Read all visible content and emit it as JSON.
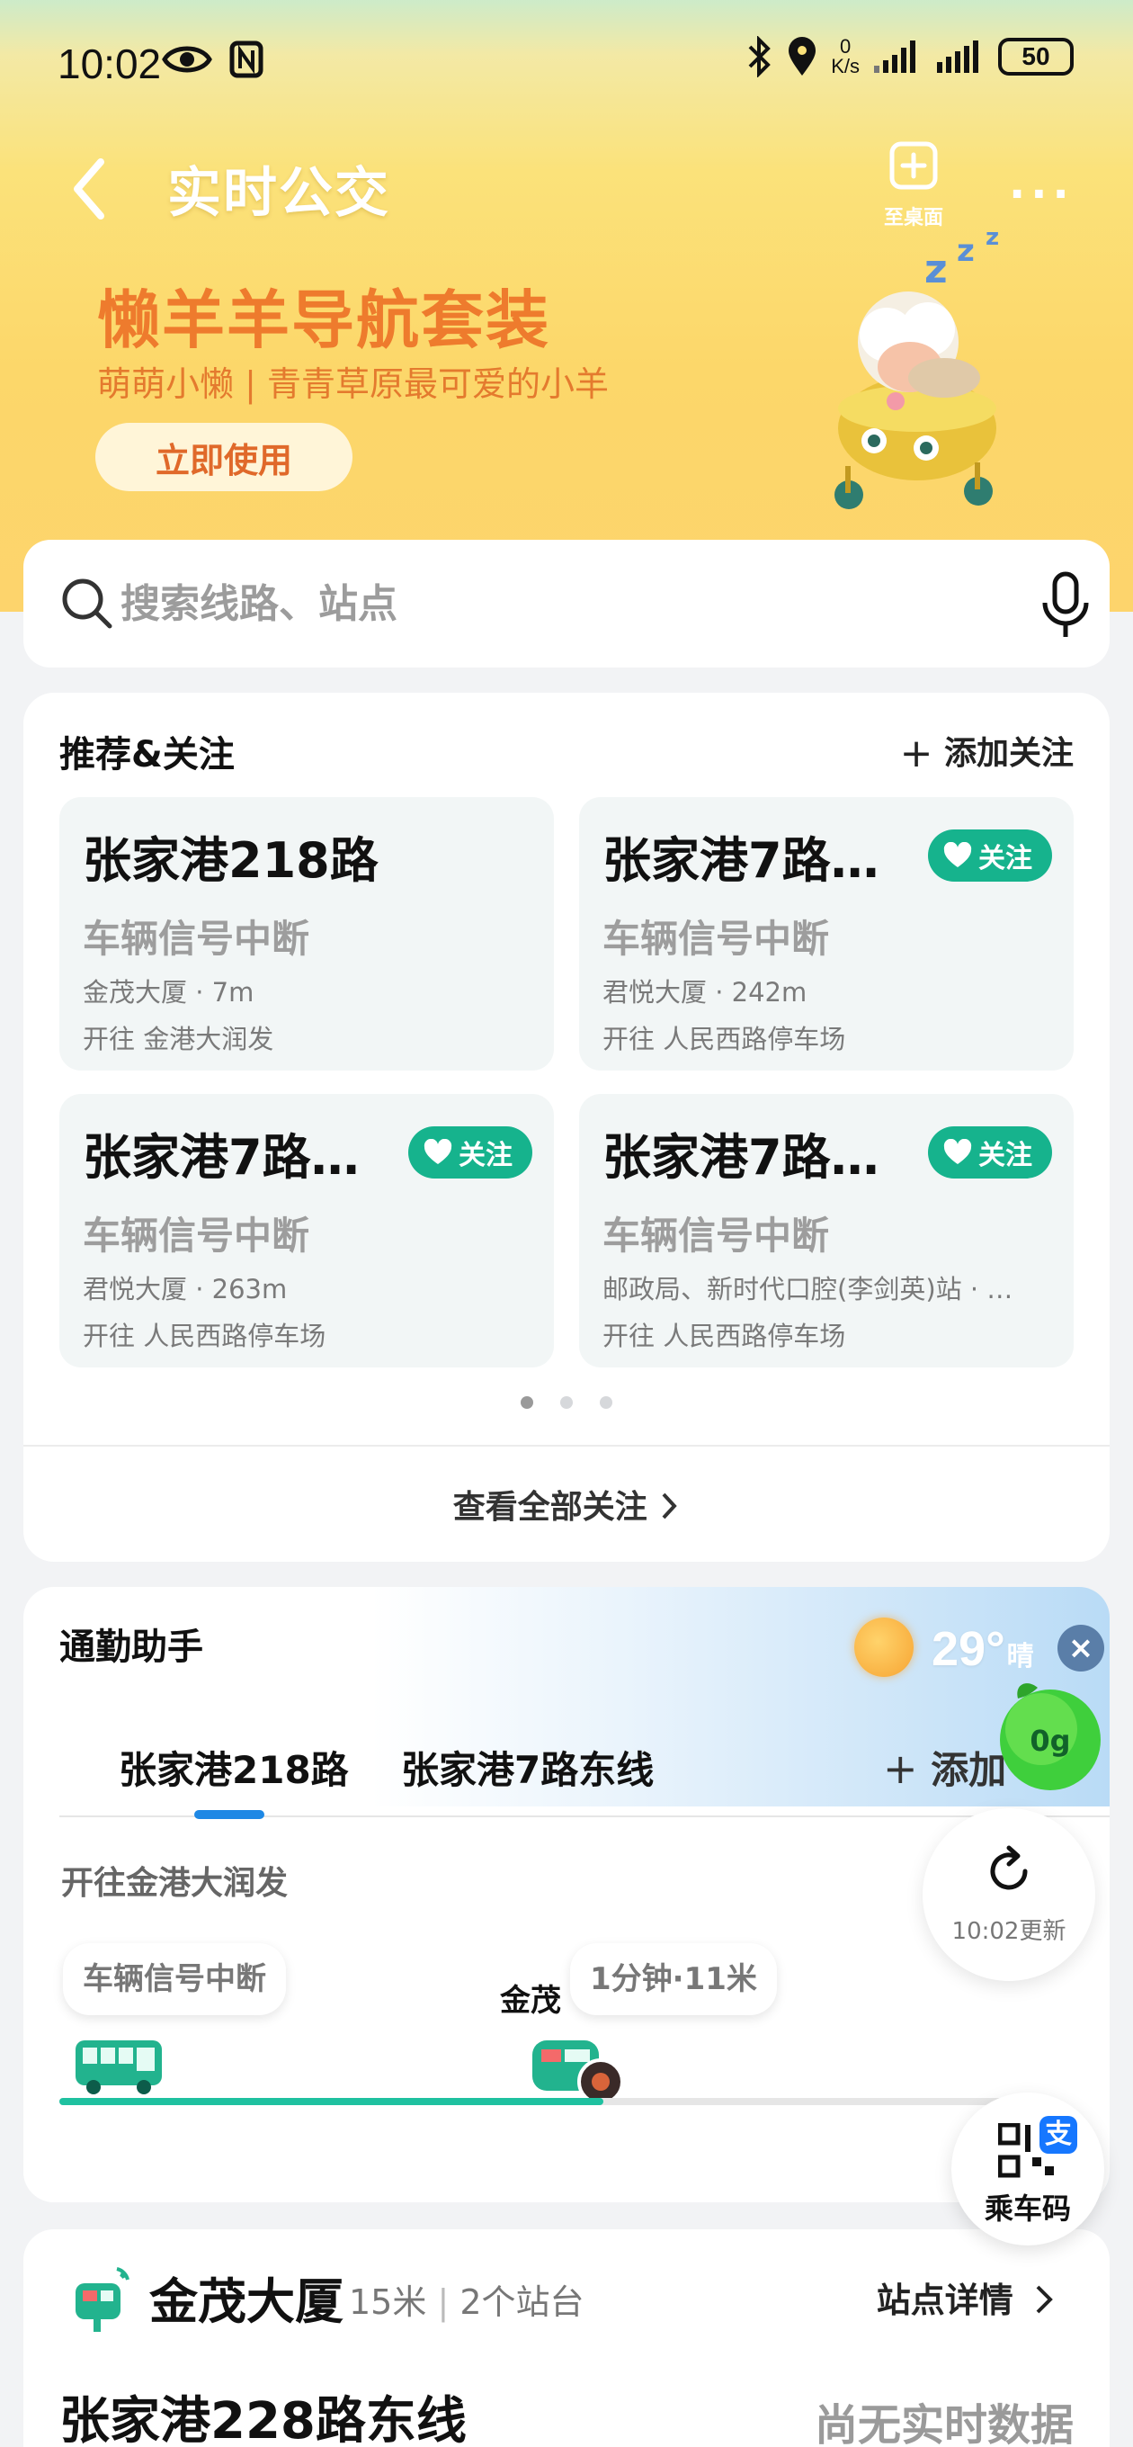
{
  "status_bar": {
    "time": "10:02",
    "net_speed_top": "0",
    "net_speed_unit": "K/s",
    "battery": "50"
  },
  "appbar": {
    "title": "实时公交",
    "desktop_label": "至桌面",
    "more": "···"
  },
  "banner": {
    "title": "懒羊羊导航套装",
    "subtitle": "萌萌小懒 | 青青草原最可爱的小羊",
    "button": "立即使用"
  },
  "search": {
    "placeholder": "搜索线路、站点"
  },
  "recommend": {
    "title": "推荐&关注",
    "add_label": "添加关注",
    "follow_label": "关注",
    "tiles": [
      {
        "name": "张家港218路",
        "status": "车辆信号中断",
        "stop": "金茂大厦 · 7m",
        "direction": "开往 金港大润发",
        "followed": false
      },
      {
        "name": "张家港7路…",
        "status": "车辆信号中断",
        "stop": "君悦大厦 · 242m",
        "direction": "开往 人民西路停车场",
        "followed": true
      },
      {
        "name": "张家港7路…",
        "status": "车辆信号中断",
        "stop": "君悦大厦 · 263m",
        "direction": "开往 人民西路停车场",
        "followed": true
      },
      {
        "name": "张家港7路…",
        "status": "车辆信号中断",
        "stop": "邮政局、新时代口腔(李剑英)站 · …",
        "direction": "开往 人民西路停车场",
        "followed": true
      }
    ],
    "page_index": 0,
    "page_count": 3,
    "view_all": "查看全部关注"
  },
  "commute": {
    "title": "通勤助手",
    "temperature": "29°",
    "weather": "晴",
    "lime_badge": "0g",
    "tabs": [
      "张家港218路",
      "张家港7路东线"
    ],
    "active_tab": 0,
    "add_label": "添加",
    "direction": "开往金港大润发",
    "bubble_left": "车辆信号中断",
    "bubble_right": "1分钟·11米",
    "stop_name": "金茂",
    "refresh_time": "10:02更新",
    "progress": 0.56
  },
  "qr": {
    "label": "乘车码",
    "badge": "支"
  },
  "station": {
    "name": "金茂大厦",
    "distance": "15米",
    "platforms": "2个站台",
    "detail": "站点详情",
    "line": "张家港228路东线",
    "realtime": "尚无实时数据"
  },
  "colors": {
    "accent": "#16b38d",
    "banner_orange": "#ee7b2d",
    "tab_blue": "#1e88e5",
    "track_green": "#1fc1a0"
  }
}
